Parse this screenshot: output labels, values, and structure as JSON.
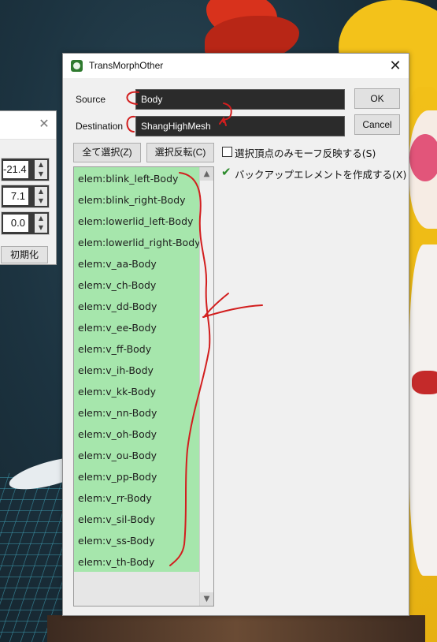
{
  "left_panel": {
    "spin_values": [
      "-21.4",
      "7.1",
      "0.0"
    ],
    "init_button": "初期化"
  },
  "dialog": {
    "title": "TransMorphOther",
    "source_label": "Source",
    "source_value": "Body",
    "destination_label": "Destination",
    "destination_value": "ShangHighMesh",
    "ok_button": "OK",
    "cancel_button": "Cancel",
    "select_all_button": "全て選択(Z)",
    "invert_selection_button": "選択反転(C)",
    "checkbox_selected_vertices": {
      "label": "選択頂点のみモーフ反映する(S)",
      "checked": false
    },
    "checkbox_backup_element": {
      "label": "バックアップエレメントを作成する(X)",
      "checked": true
    },
    "list_items": [
      "elem:blink_left-Body",
      "elem:blink_right-Body",
      "elem:lowerlid_left-Body",
      "elem:lowerlid_right-Body",
      "elem:v_aa-Body",
      "elem:v_ch-Body",
      "elem:v_dd-Body",
      "elem:v_ee-Body",
      "elem:v_ff-Body",
      "elem:v_ih-Body",
      "elem:v_kk-Body",
      "elem:v_nn-Body",
      "elem:v_oh-Body",
      "elem:v_ou-Body",
      "elem:v_pp-Body",
      "elem:v_rr-Body",
      "elem:v_sil-Body",
      "elem:v_ss-Body",
      "elem:v_th-Body"
    ]
  },
  "colors": {
    "list_selected": "#a6e6ac",
    "field_bg": "#2b2b2b",
    "annotation": "#d21e1e"
  }
}
